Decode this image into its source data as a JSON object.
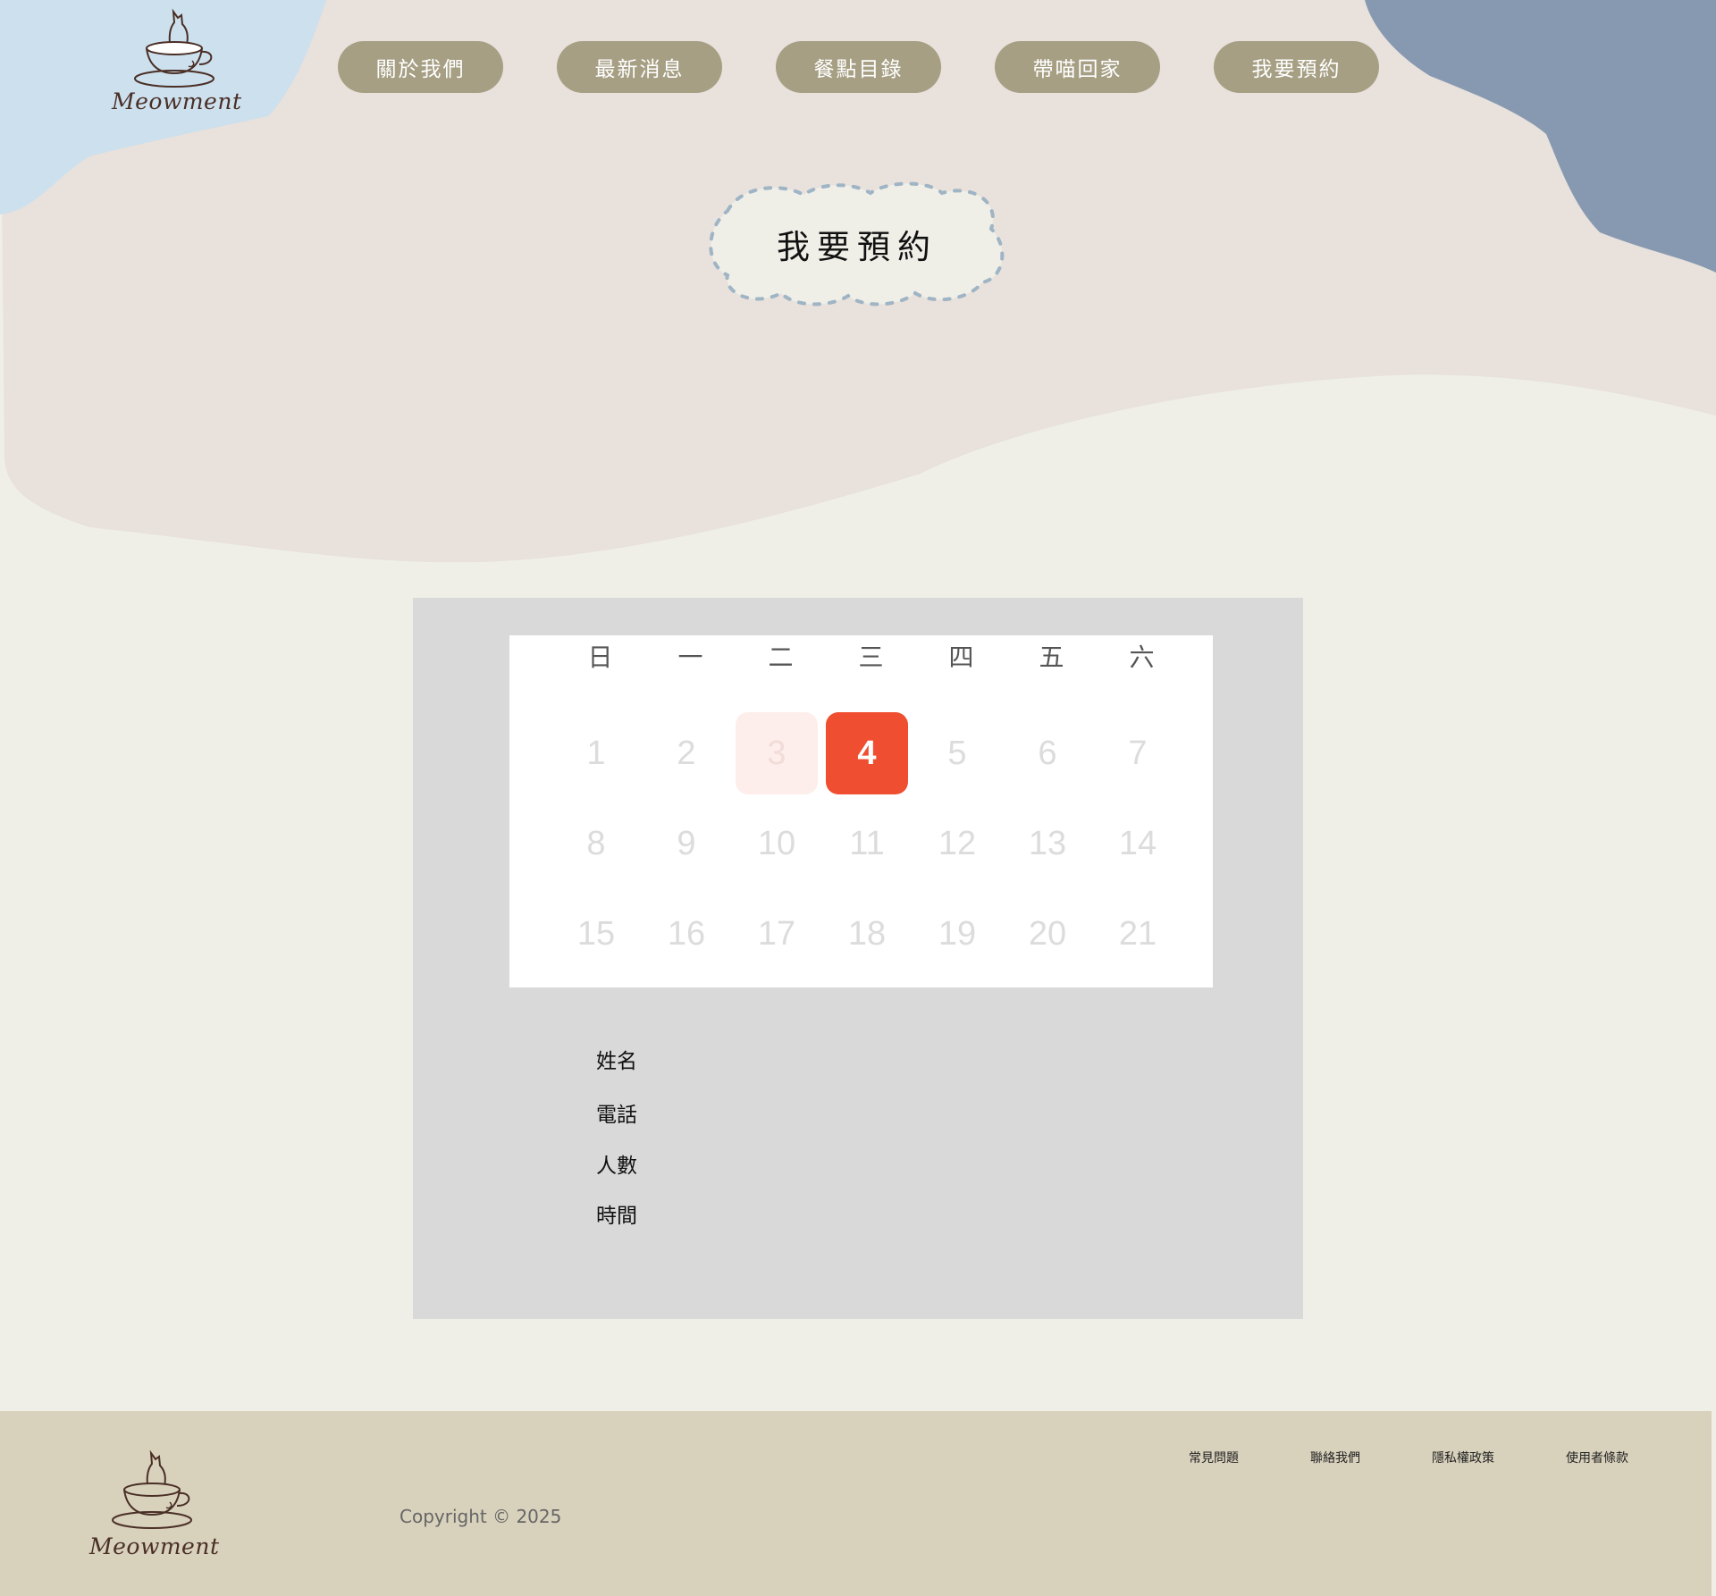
{
  "brand": {
    "logo_text": "Meowment"
  },
  "nav": {
    "items": [
      {
        "label": "關於我們"
      },
      {
        "label": "最新消息"
      },
      {
        "label": "餐點目錄"
      },
      {
        "label": "帶喵回家"
      },
      {
        "label": "我要預約"
      }
    ]
  },
  "page": {
    "title": "我要預約"
  },
  "calendar": {
    "weekdays": [
      "日",
      "一",
      "二",
      "三",
      "四",
      "五",
      "六"
    ],
    "weeks": [
      [
        "1",
        "2",
        "3",
        "4",
        "5",
        "6",
        "7"
      ],
      [
        "8",
        "9",
        "10",
        "11",
        "12",
        "13",
        "14"
      ],
      [
        "15",
        "16",
        "17",
        "18",
        "19",
        "20",
        "21"
      ]
    ],
    "today": "3",
    "selected": "4"
  },
  "form": {
    "name_label": "姓名",
    "phone_label": "電話",
    "people_label": "人數",
    "time_label": "時間"
  },
  "footer": {
    "logo_text": "Meowment",
    "copyright": "Copyright © 2025",
    "links": [
      {
        "label": "常見問題"
      },
      {
        "label": "聯絡我們"
      },
      {
        "label": "隱私權政策"
      },
      {
        "label": "使用者條款"
      }
    ]
  },
  "colors": {
    "page_bg": "#efefe8",
    "header_blob": "#e8e1dc",
    "blue_light": "#cde0ee",
    "blue_dark": "#8799b1",
    "nav_button": "#a69f84",
    "panel_bg": "#d9d9d9",
    "accent": "#f04e30",
    "footer_bg": "#d8d1bc",
    "logo_brown": "#4a2f26"
  }
}
